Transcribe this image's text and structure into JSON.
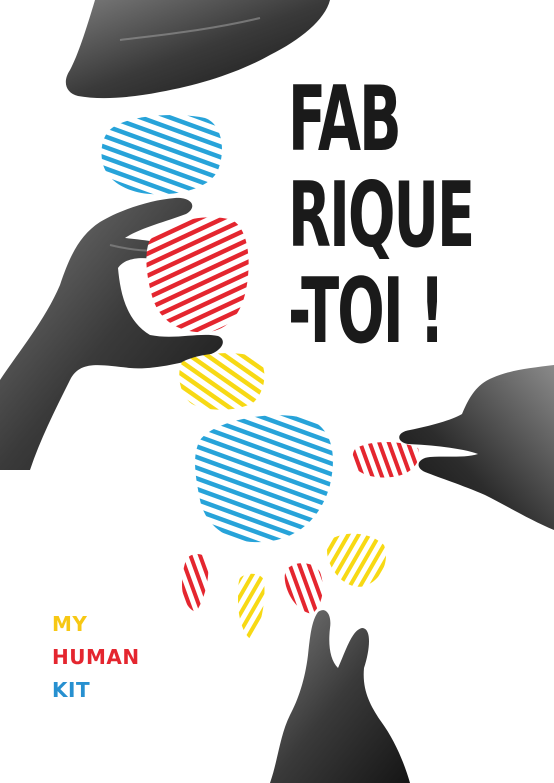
{
  "headline": {
    "line1": "FAB",
    "line2": "RIQUE",
    "line3": "-TOI !"
  },
  "brand": {
    "word1": "MY",
    "word2": "HUMAN",
    "word3": "KIT"
  },
  "colors": {
    "blue": "#27a3d9",
    "red": "#e4262f",
    "yellow": "#f7d914",
    "ink": "#1a1a1a",
    "background": "#ffffff"
  },
  "icons": [
    "fingerprint-head",
    "fingerprint-neck",
    "fingerprint-torso",
    "fingerprint-pelvis",
    "fingerprint-hand",
    "fingerprint-fingers",
    "photo-hands"
  ]
}
